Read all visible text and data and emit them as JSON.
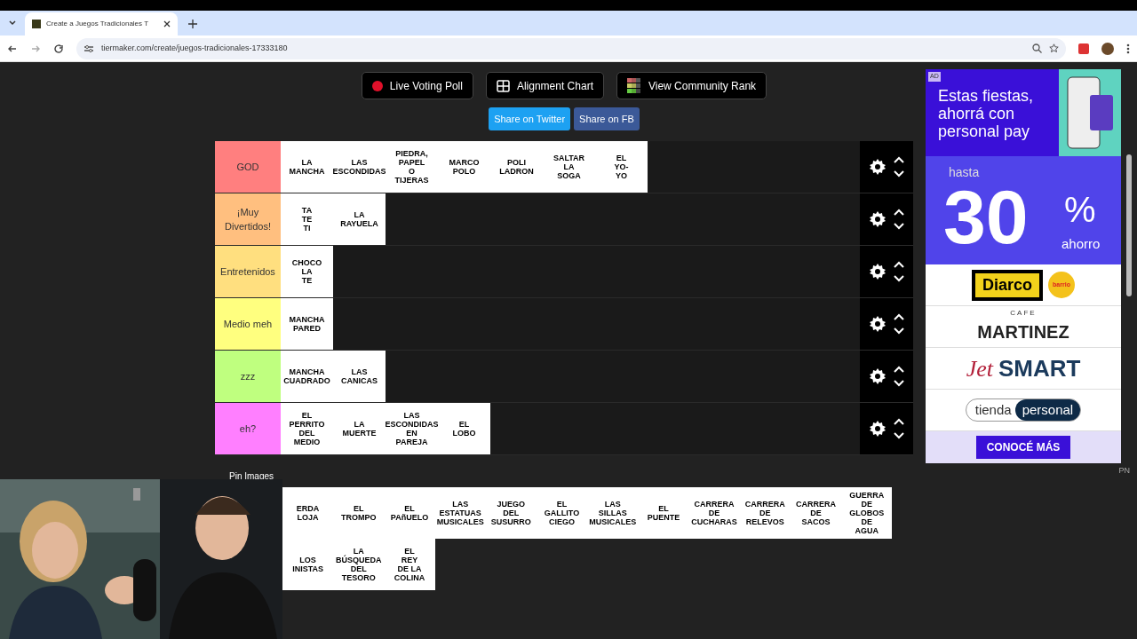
{
  "browser": {
    "tab_title": "Create a Juegos Tradicionales T",
    "url": "tiermaker.com/create/juegos-tradicionales-17333180"
  },
  "toolbar": {
    "buttons": [
      {
        "kind": "live",
        "label": "Live Voting Poll"
      },
      {
        "kind": "grid",
        "label": "Alignment Chart"
      },
      {
        "kind": "rank",
        "label": "View Community Rank"
      }
    ],
    "share": [
      {
        "kind": "twitter",
        "label": "Share on Twitter"
      },
      {
        "kind": "fb",
        "label": "Share on FB"
      }
    ]
  },
  "tiers": [
    {
      "label": "GOD",
      "color": "#ff7f7f",
      "items": [
        "LA\nMANCHA",
        "LAS\nESCONDIDAS",
        "PIEDRA,\nPAPEL\nO\nTIJERAS",
        "MARCO\nPOLO",
        "POLI\nLADRON",
        "SALTAR\nLA\nSOGA",
        "EL\nYO-\nYO"
      ]
    },
    {
      "label": "¡Muy Divertidos!",
      "color": "#ffbf7f",
      "items": [
        "TA\nTE\nTI",
        "LA\nRAYUELA"
      ]
    },
    {
      "label": "Entretenidos",
      "color": "#ffdf7f",
      "items": [
        "CHOCO\nLA\nTE"
      ]
    },
    {
      "label": "Medio meh",
      "color": "#ffff7f",
      "items": [
        "MANCHA\nPARED"
      ]
    },
    {
      "label": "zzz",
      "color": "#bfff7f",
      "items": [
        "MANCHA\nCUADRADO",
        "LAS\nCANICAS"
      ]
    },
    {
      "label": "eh?",
      "color": "#ff7fff",
      "items": [
        "EL\nPERRITO\nDEL\nMEDIO",
        "LA\nMUERTE",
        "LAS\nESCONDIDAS\nEN\nPAREJA",
        "EL\nLOBO"
      ]
    }
  ],
  "pin_label": "Pin Images",
  "pool": [
    [
      "ERDA\nLOJA",
      "EL\nTROMPO",
      "EL\nPAñUELO",
      "LAS\nESTATUAS\nMUSICALES",
      "JUEGO\nDEL\nSUSURRO",
      "EL\nGALLITO\nCIEGO",
      "LAS\nSILLAS\nMUSICALES",
      "EL\nPUENTE",
      "CARRERA\nDE\nCUCHARAS",
      "CARRERA\nDE\nRELEVOS",
      "CARRERA\nDE\nSACOS",
      "GUERRA\nDE\nGLOBOS\nDE\nAGUA"
    ],
    [
      "LOS\nINISTAS",
      "LA\nBÚSQUEDA\nDEL\nTESORO",
      "EL\nREY\nDE LA\nCOLINA"
    ]
  ],
  "ad": {
    "badge": "AD",
    "headline": "Estas fiestas, ahorrá con personal pay",
    "pre": "hasta",
    "big": "30",
    "pct": "%",
    "post": "ahorro",
    "brands": [
      {
        "kind": "diarco",
        "text": "Diarco",
        "extra": "barrio"
      },
      {
        "kind": "cafe",
        "text": "MARTINEZ",
        "extra": "CAFE"
      },
      {
        "kind": "jet",
        "text": "SMART",
        "extra": "Jet"
      },
      {
        "kind": "tienda",
        "text": "personal",
        "extra": "tienda"
      }
    ],
    "cta": "CONOCÉ MÁS",
    "corner": "PN"
  }
}
